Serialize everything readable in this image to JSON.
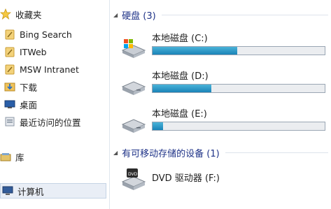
{
  "sidebar": {
    "favorites_label": "收藏夹",
    "items": [
      {
        "label": "Bing Search",
        "icon": "favorite-link-icon"
      },
      {
        "label": "ITWeb",
        "icon": "favorite-link-icon"
      },
      {
        "label": "MSW Intranet",
        "icon": "favorite-link-icon"
      },
      {
        "label": "下载",
        "icon": "download-folder-icon"
      },
      {
        "label": "桌面",
        "icon": "desktop-icon"
      },
      {
        "label": "最近访问的位置",
        "icon": "recent-places-icon"
      }
    ],
    "library_label": "库",
    "computer_label": "计算机"
  },
  "groups": {
    "hard_disks": {
      "title": "硬盘 (3)"
    },
    "removable": {
      "title": "有可移动存储的设备 (1)"
    }
  },
  "drives": [
    {
      "label": "本地磁盘 (C:)",
      "used_fraction": 0.49
    },
    {
      "label": "本地磁盘 (D:)",
      "used_fraction": 0.34
    },
    {
      "label": "本地磁盘 (E:)",
      "used_fraction": 0.06
    }
  ],
  "dvd": {
    "label": "DVD 驱动器 (F:)"
  },
  "colors": {
    "bar_fill": "#2a95c6",
    "bar_track": "#ebedf0",
    "group_header": "#1e3287",
    "selection": "#e9eef6"
  }
}
